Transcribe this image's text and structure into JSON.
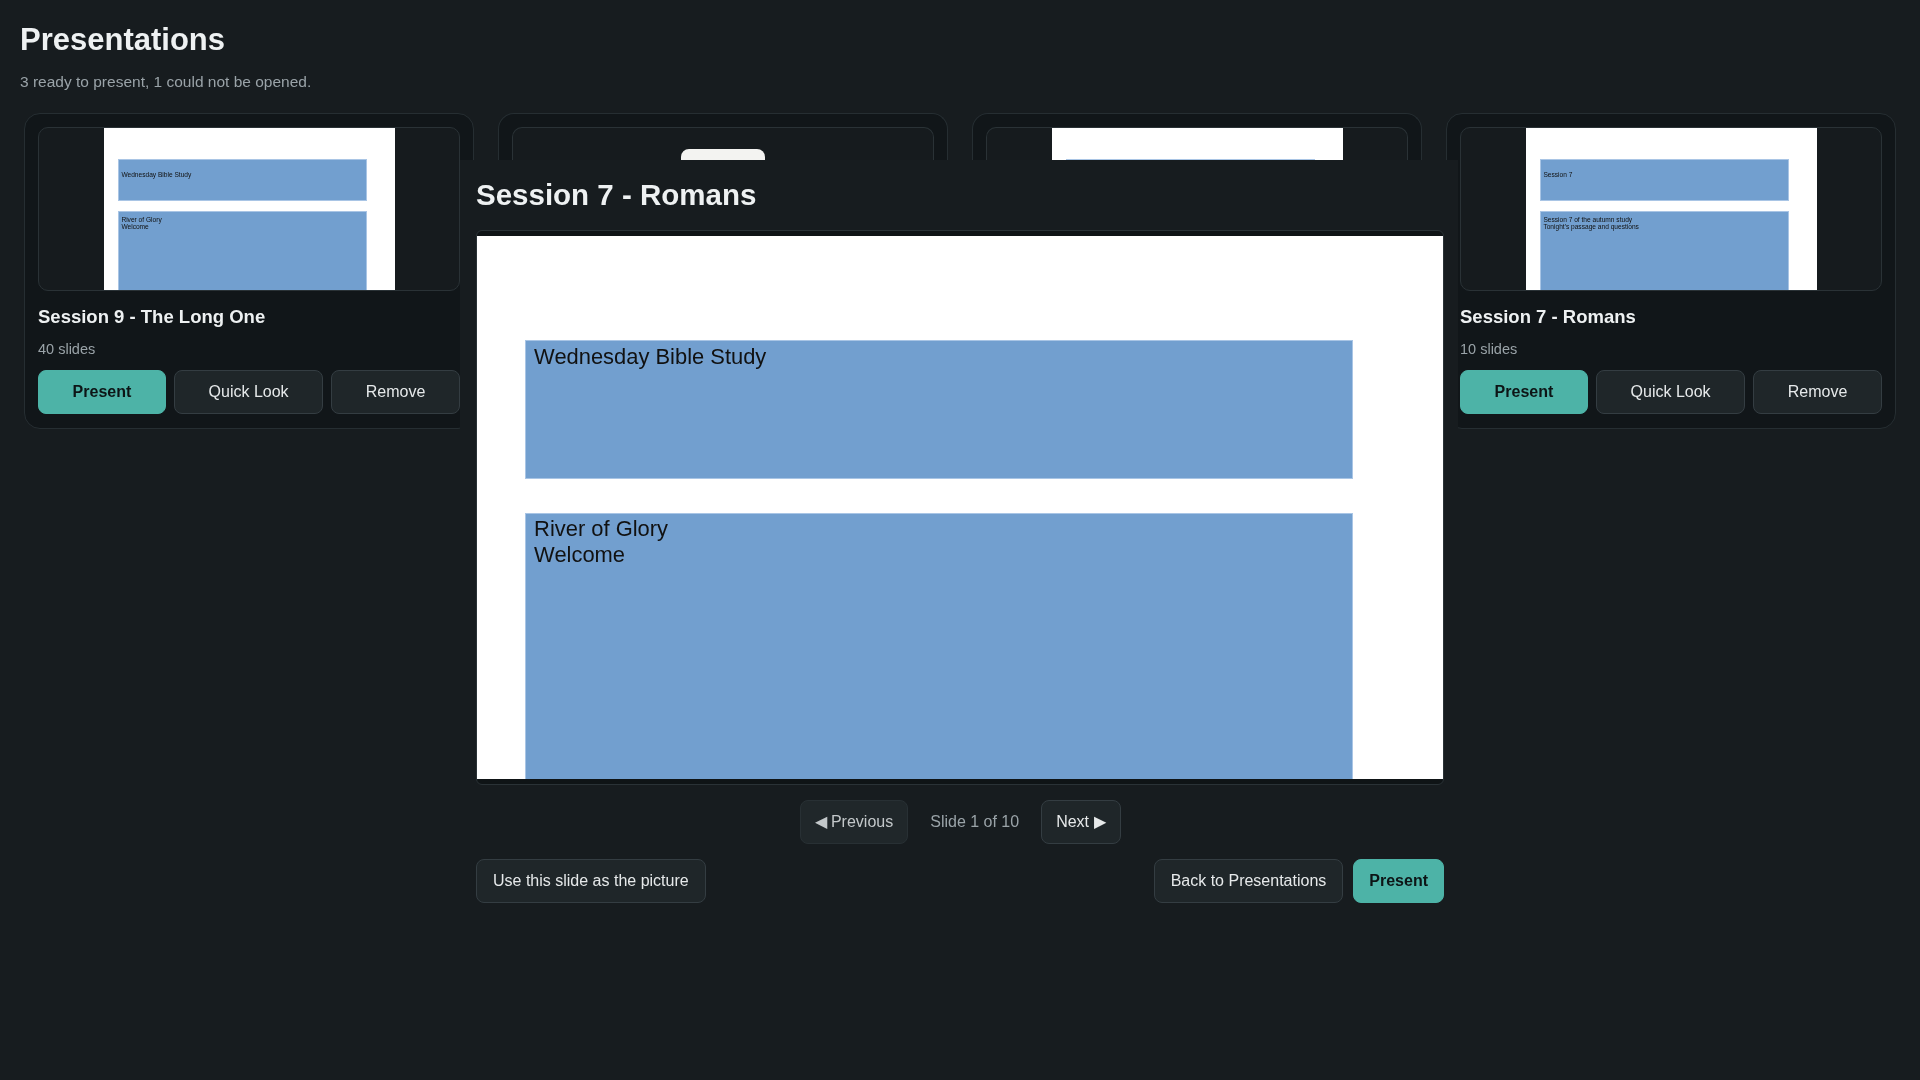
{
  "page": {
    "title": "Presentations",
    "summary": "3 ready to present, 1 could not be opened."
  },
  "presentations": [
    {
      "title": "Session 9 - The Long One",
      "slide_count": "40 slides",
      "thumbnail": {
        "kind": "slide",
        "boxes": [
          {
            "lines": [
              "Wednesday Bible Study"
            ]
          },
          {
            "lines": [
              "River of Glory",
              "Welcome"
            ]
          }
        ]
      },
      "actions": [
        {
          "label": "Present",
          "kind": "primary"
        },
        {
          "label": "Quick Look",
          "kind": "secondary"
        },
        {
          "label": "Remove",
          "kind": "secondary"
        }
      ]
    },
    {
      "thumbnail": {
        "kind": "placeholder"
      }
    },
    {
      "thumbnail": {
        "kind": "slide"
      }
    },
    {
      "title": "Session 7 - Romans",
      "slide_count": "10 slides",
      "thumbnail": {
        "kind": "slide",
        "boxes": [
          {
            "lines": [
              "Session 7"
            ]
          },
          {
            "lines": [
              "Session 7 of the autumn study",
              "Tonight's passage and questions"
            ]
          }
        ]
      },
      "actions": [
        {
          "label": "Present",
          "kind": "primary"
        },
        {
          "label": "Quick Look",
          "kind": "secondary"
        },
        {
          "label": "Remove",
          "kind": "secondary"
        }
      ]
    }
  ],
  "quick_look": {
    "title": "Session 7 - Romans",
    "slide": {
      "boxes": [
        {
          "lines": [
            "Wednesday Bible Study"
          ]
        },
        {
          "lines": [
            "River of Glory",
            "Welcome"
          ]
        }
      ]
    },
    "previous": {
      "label": "◀ Previous",
      "disabled": true
    },
    "position": "Slide 1 of 10",
    "next": {
      "label": "Next ▶",
      "disabled": false
    },
    "slide_actions": [
      {
        "label": "Use this slide as the picture",
        "kind": "secondary"
      }
    ],
    "dialog_actions": [
      {
        "label": "Back to Presentations",
        "kind": "secondary"
      },
      {
        "label": "Present",
        "kind": "primary"
      }
    ]
  }
}
